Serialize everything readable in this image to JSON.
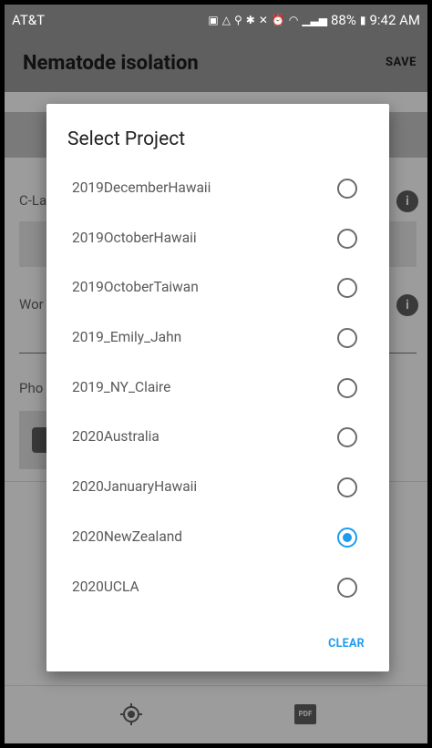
{
  "status_bar": {
    "carrier": "AT&T",
    "battery": "88%",
    "time": "9:42 AM",
    "icons": [
      "notification-icon",
      "drive-icon",
      "location-icon",
      "bluetooth-icon",
      "mute-icon",
      "alarm-icon",
      "wifi-icon",
      "signal-icon",
      "battery-icon"
    ]
  },
  "app_bar": {
    "title": "Nematode isolation",
    "save_label": "SAVE"
  },
  "background_form": {
    "field1_label": "C-La",
    "field2_label": "Wor",
    "photos_label": "Pho"
  },
  "dialog": {
    "title": "Select Project",
    "options": [
      {
        "label": "2019DecemberHawaii",
        "selected": false
      },
      {
        "label": "2019OctoberHawaii",
        "selected": false
      },
      {
        "label": "2019OctoberTaiwan",
        "selected": false
      },
      {
        "label": "2019_Emily_Jahn",
        "selected": false
      },
      {
        "label": "2019_NY_Claire",
        "selected": false
      },
      {
        "label": "2020Australia",
        "selected": false
      },
      {
        "label": "2020JanuaryHawaii",
        "selected": false
      },
      {
        "label": "2020NewZealand",
        "selected": true
      },
      {
        "label": "2020UCLA",
        "selected": false
      }
    ],
    "clear_label": "CLEAR"
  },
  "bottom_bar": {
    "pdf_text": "PDF"
  },
  "colors": {
    "accent": "#1e9bf0",
    "dim_overlay": "#9c9c9c"
  }
}
